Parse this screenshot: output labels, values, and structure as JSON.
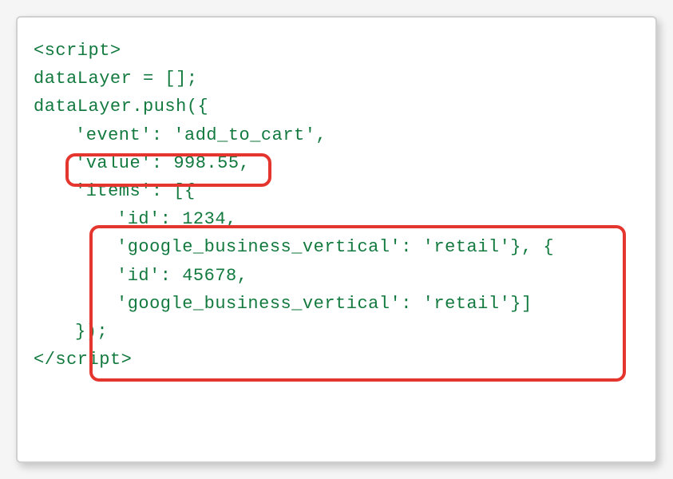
{
  "code": {
    "line1": "<script>",
    "line2": "dataLayer = [];",
    "line3": "dataLayer.push({",
    "line4": "'event': 'add_to_cart',",
    "line5": "'value': 998.55,",
    "line6": "'items': [{",
    "line7": "'id': 1234,",
    "line8": "'google_business_vertical': 'retail'}, {",
    "line9": "'id': 45678,",
    "line10": "'google_business_vertical': 'retail'}]",
    "line11": "});",
    "line12": "</script>"
  },
  "highlights": {
    "value_box": "value-highlight",
    "items_box": "items-highlight"
  }
}
